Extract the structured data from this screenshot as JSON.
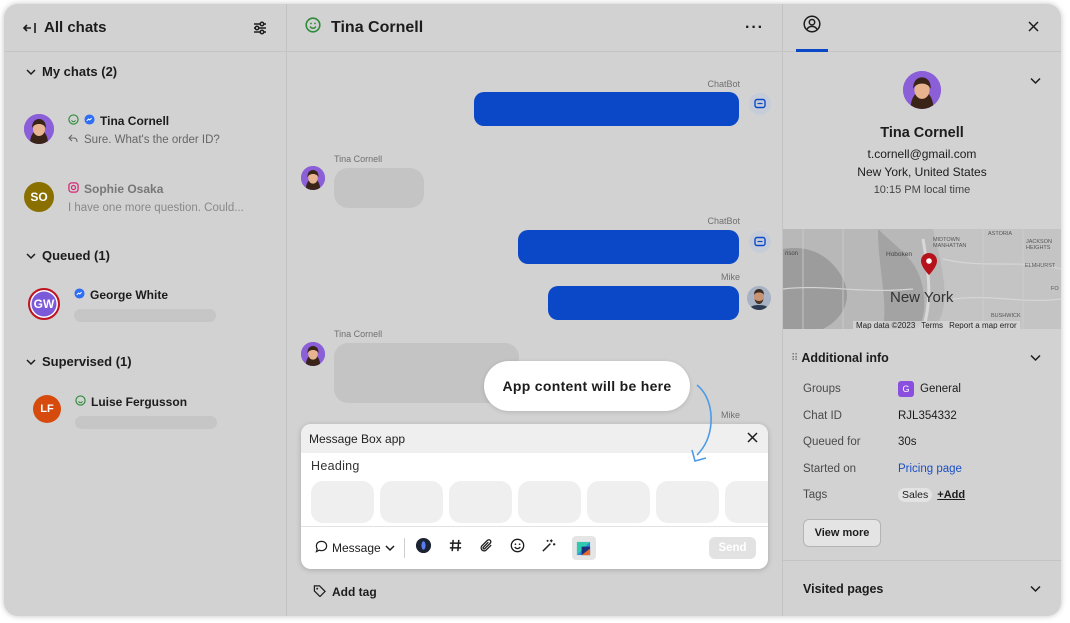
{
  "left_panel": {
    "header_title": "All chats",
    "sections": {
      "my_chats": {
        "label": "My chats (2)"
      },
      "queued": {
        "label": "Queued (1)"
      },
      "supervised": {
        "label": "Supervised (1)"
      }
    },
    "chats": {
      "tina": {
        "name": "Tina Cornell",
        "preview": "Sure. What's the order ID?"
      },
      "sophie": {
        "name": "Sophie Osaka",
        "preview": "I have one more question. Could...",
        "initials": "SO",
        "avatar_color": "#8a7000"
      },
      "george": {
        "name": "George White",
        "initials": "GW",
        "avatar_color": "#7b5ad9",
        "ring_color": "#c0151f"
      },
      "luise": {
        "name": "Luise  Fergusson",
        "initials": "LF",
        "avatar_color": "#d64a0e"
      }
    }
  },
  "conversation": {
    "title": "Tina Cornell",
    "senders": {
      "chatbot_1": "ChatBot",
      "tina_1": "Tina Cornell",
      "chatbot_2": "ChatBot",
      "mike_1": "Mike",
      "tina_2": "Tina Cornell",
      "mike_2": "Mike"
    },
    "callout": "App content will be here",
    "app_panel": {
      "title": "Message Box app",
      "heading": "Heading",
      "tile_count": 7
    },
    "composer": {
      "mode_label": "Message",
      "send_label": "Send"
    },
    "add_tag_label": "Add tag"
  },
  "details": {
    "name": "Tina Cornell",
    "email": "t.cornell@gmail.com",
    "location": "New York, United States",
    "local_time": "10:15 PM local time",
    "map": {
      "city": "New York",
      "labels": {
        "hoboken": "Hoboken",
        "midtown": "MIDTOWN\nMANHATTAN",
        "astoria": "ASTORIA",
        "jackson": "JACKSON\nHEIGHTS",
        "elmhurst": "ELMHURST",
        "bushwick": "BUSHWICK",
        "ris": "rison",
        "fo": "FO"
      },
      "footer_data": "Map data ©2023",
      "footer_terms": "Terms",
      "footer_report": "Report a map error"
    },
    "additional_info": {
      "title": "Additional info",
      "rows": {
        "groups": {
          "key": "Groups",
          "value": "General",
          "badge": "G",
          "badge_color": "#8b4fe0"
        },
        "chat_id": {
          "key": "Chat ID",
          "value": "RJL354332"
        },
        "queued_for": {
          "key": "Queued for",
          "value": "30s"
        },
        "started_on": {
          "key": "Started on",
          "value": "Pricing page"
        },
        "tags": {
          "key": "Tags",
          "value": "Sales",
          "add": "+Add"
        }
      },
      "view_more": "View more"
    },
    "visited_pages": "Visited pages"
  },
  "colors": {
    "accent_blue": "#0a48c8",
    "link_blue": "#1c4fc4",
    "online_green": "#2e8b3a",
    "messenger": "#2d6ef5",
    "instagram": "#d62976",
    "pin_red": "#b5121b"
  }
}
